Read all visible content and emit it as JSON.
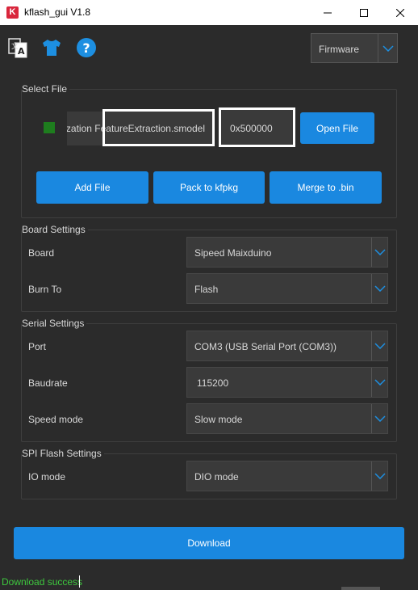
{
  "window": {
    "title": "kflash_gui V1.8",
    "app_icon_letter": "K"
  },
  "toolbar": {
    "language_icon": "language-icon",
    "skin_icon": "tshirt-icon",
    "help_icon": "help-icon",
    "firmware_label": "Firmware"
  },
  "select_file": {
    "title": "Select File",
    "file_path": "...izationFeatureExtraction.smodel",
    "file_path_visible": "ization FeatureExtraction.smodel",
    "address": "0x500000",
    "open_file": "Open File",
    "add_file": "Add File",
    "pack": "Pack to kfpkg",
    "merge": "Merge to .bin",
    "indicator_color": "#1e7d1e"
  },
  "board_settings": {
    "title": "Board Settings",
    "board_label": "Board",
    "board_value": "Sipeed Maixduino",
    "burn_label": "Burn To",
    "burn_value": "Flash"
  },
  "serial_settings": {
    "title": "Serial Settings",
    "port_label": "Port",
    "port_value": "COM3 (USB Serial Port (COM3))",
    "baud_label": "Baudrate",
    "baud_value": "115200",
    "speed_label": "Speed mode",
    "speed_value": "Slow mode"
  },
  "spi_settings": {
    "title": "SPI Flash Settings",
    "io_label": "IO mode",
    "io_value": "DIO mode"
  },
  "download": {
    "label": "Download"
  },
  "status": {
    "text": "Download success",
    "color": "#3ec83e"
  },
  "colors": {
    "accent": "#1a88e0",
    "background": "#2b2b2b"
  }
}
